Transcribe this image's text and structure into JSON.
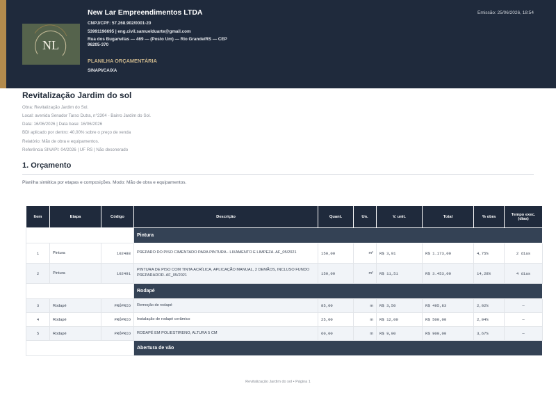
{
  "header": {
    "company_name": "New Lar Empreendimentos LTDA",
    "cnpj": "CNPJ/CPF: 57.268.902/0001-20",
    "contact": "53991196695 | eng.civil.samuelduarte@gmail.com",
    "address_line1": "Rua dos Buganvilas — 469 — (Posto Um) — Rio Grande/RS — CEP",
    "address_line2": "96205-370",
    "document_type": "PLANILHA ORÇAMENTÁRIA",
    "reference_base": "SINAPI/CAIXA",
    "emission": "Emissão: 25/06/2026, 18:54",
    "logo_letters": "NL",
    "colors": {
      "header_bg": "#1f2a3c",
      "accent_gold": "#b38b4d",
      "logo_bg": "#55634c"
    }
  },
  "project": {
    "title": "Revitalização Jardim do sol",
    "meta": [
      "Obra: Revitalização Jardim do Sol.",
      "Local: avenida Senador Tarso Dutra, n°2304 - Bairro Jardim do Sol.",
      "Data: 16/06/2026 | Data base: 16/06/2026",
      "BDI aplicado por dentro: 40,00% sobre o preço de venda",
      "Relatório: Mão de obra e equipamentos.",
      "Referência SINAPI: 04/2026 | UF RS | Não desonerado"
    ]
  },
  "section": {
    "title": "1. Orçamento",
    "subtitle": "Planilha sintética por etapas e composições. Modo: Mão de obra e equipamentos."
  },
  "table": {
    "columns": [
      "Item",
      "Etapa",
      "Código",
      "Descrição",
      "Quant.",
      "Un.",
      "V. unit.",
      "Total",
      "% obra",
      "Tempo exec. (dias)"
    ],
    "stages": [
      {
        "name": "Pintura",
        "rows": [
          {
            "item": "1",
            "etapa": "Pintura",
            "codigo": "102488",
            "descricao": "PREPARO DO PISO CIMENTADO PARA PINTURA - LIXAMENTO E LIMPEZA. AF_05/2021",
            "quant": "150,00",
            "un": "m²",
            "vunit": "R$ 3,91",
            "total": "R$ 1.173,00",
            "pct": "4,75%",
            "tempo": "2 dias"
          },
          {
            "item": "2",
            "etapa": "Pintura",
            "codigo": "102491",
            "descricao": "PINTURA DE PISO COM TINTA ACRÍLICA, APLICAÇÃO MANUAL, 2 DEMÃOS, INCLUSO FUNDO PREPARADOR. AF_05/2021",
            "quant": "150,00",
            "un": "m²",
            "vunit": "R$ 11,51",
            "total": "R$ 3.453,00",
            "pct": "14,28%",
            "tempo": "4 dias"
          }
        ]
      },
      {
        "name": "Rodapé",
        "rows": [
          {
            "item": "3",
            "etapa": "Rodapé",
            "codigo": "PRÓPRIO",
            "descricao": "Remoção de rodapé",
            "quant": "85,00",
            "un": "m",
            "vunit": "R$ 3,50",
            "total": "R$ 495,83",
            "pct": "2,02%",
            "tempo": "—"
          },
          {
            "item": "4",
            "etapa": "Rodapé",
            "codigo": "PRÓPRIO",
            "descricao": "Instalação de rodapé cerâmico",
            "quant": "25,00",
            "un": "m",
            "vunit": "R$ 12,00",
            "total": "R$ 500,00",
            "pct": "2,04%",
            "tempo": "—"
          },
          {
            "item": "5",
            "etapa": "Rodapé",
            "codigo": "PRÓPRIO",
            "descricao": "RODAPÉ EM POLIESTIRENO, ALTURA 5 CM",
            "quant": "60,00",
            "un": "m",
            "vunit": "R$ 9,00",
            "total": "R$ 900,00",
            "pct": "3,67%",
            "tempo": "—"
          }
        ]
      },
      {
        "name": "Abertura de vão",
        "rows": []
      }
    ]
  },
  "footer": {
    "text": "Revitalização Jardim do sol • Página 1"
  }
}
